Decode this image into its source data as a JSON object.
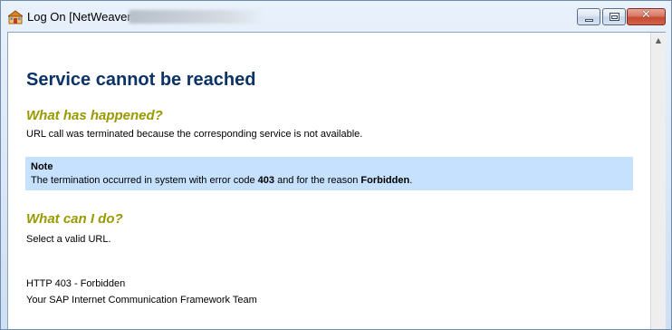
{
  "window": {
    "title": "Log On [NetWeaver",
    "title_redacted": true
  },
  "icons": {
    "app": "sap-logon-icon",
    "minimize": "minimize-icon",
    "maximize": "maximize-icon",
    "close": "close-icon",
    "scroll_up": "scroll-up-arrow-icon"
  },
  "page": {
    "heading": "Service cannot be reached",
    "section1": {
      "title": "What has happened?",
      "text": "URL call was terminated because the corresponding service is not available."
    },
    "note": {
      "title": "Note",
      "text_before_code": "The termination occurred in system with error code ",
      "error_code": "403",
      "text_before_reason": " and for the reason ",
      "reason": "Forbidden",
      "text_end": "."
    },
    "section2": {
      "title": "What can I do?",
      "text": "Select a valid URL."
    },
    "footer": {
      "status": "HTTP 403 - Forbidden",
      "team": "Your SAP Internet Communication Framework Team"
    }
  },
  "colors": {
    "heading": "#0b3367",
    "subheading": "#999900",
    "note_background": "#c5e1fd",
    "close_button": "#c74a33"
  }
}
